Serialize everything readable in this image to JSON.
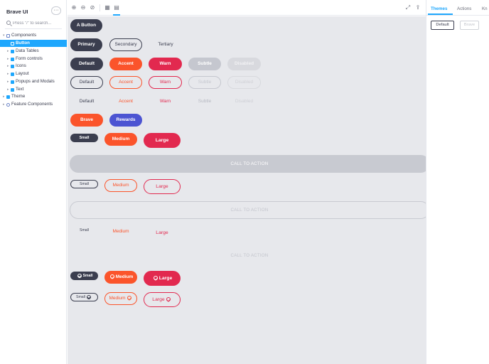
{
  "app": {
    "title": "Brave UI",
    "more_label": "···"
  },
  "search": {
    "placeholder": "Press \"/\" to search..."
  },
  "tree": {
    "components": "Components",
    "button": "Button",
    "data_tables": "Data Tables",
    "form_controls": "Form controls",
    "icons": "Icons",
    "layout": "Layout",
    "popups": "Popups and Modals",
    "text": "Text",
    "theme": "Theme",
    "feature": "Feature Components"
  },
  "toolbar": {
    "icons": [
      "zoom-in-icon",
      "zoom-out-icon",
      "zoom-reset-icon",
      "grid-icon",
      "background-icon",
      "fullscreen-icon",
      "share-icon"
    ]
  },
  "buttons": {
    "a_button": "A Button",
    "primary": "Primary",
    "secondary": "Secondary",
    "tertiary": "Tertiary",
    "default": "Default",
    "accent": "Accent",
    "warn": "Warn",
    "subtle": "Subtle",
    "disabled": "Disabled",
    "brave": "Brave",
    "rewards": "Rewards",
    "small": "Small",
    "medium": "Medium",
    "large": "Large",
    "cta": "CALL TO ACTION"
  },
  "addons": {
    "tabs": [
      "Themes",
      "Actions",
      "Kn"
    ],
    "theme_default": "Default",
    "theme_dark": "Brave Dark"
  },
  "colors": {
    "selected": "#1ea7fd",
    "dark": "#3b3e4f",
    "accent": "#fb542b",
    "warn": "#e2294f",
    "rewards": "#4c54d2",
    "subtle": "#c5c7cf",
    "canvas": "#e7e8ec"
  }
}
